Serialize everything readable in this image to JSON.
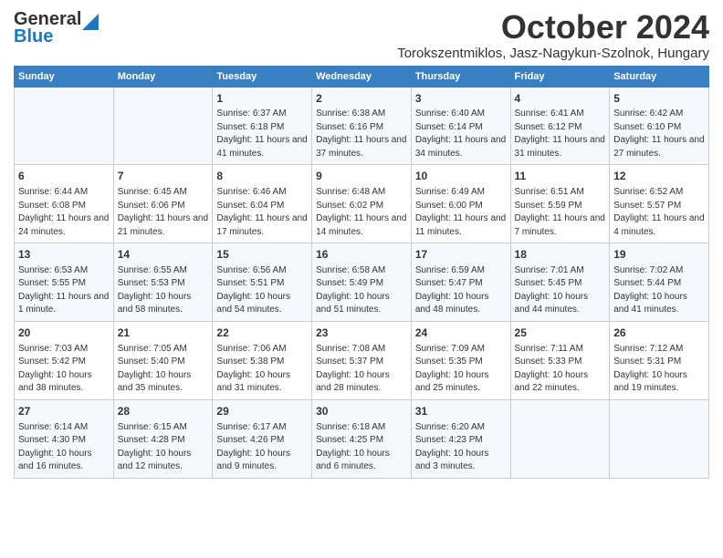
{
  "header": {
    "logo_general": "General",
    "logo_blue": "Blue",
    "month_title": "October 2024",
    "location": "Torokszentmiklos, Jasz-Nagykun-Szolnok, Hungary"
  },
  "days_of_week": [
    "Sunday",
    "Monday",
    "Tuesday",
    "Wednesday",
    "Thursday",
    "Friday",
    "Saturday"
  ],
  "weeks": [
    [
      {
        "day": "",
        "info": ""
      },
      {
        "day": "",
        "info": ""
      },
      {
        "day": "1",
        "info": "Sunrise: 6:37 AM\nSunset: 6:18 PM\nDaylight: 11 hours and 41 minutes."
      },
      {
        "day": "2",
        "info": "Sunrise: 6:38 AM\nSunset: 6:16 PM\nDaylight: 11 hours and 37 minutes."
      },
      {
        "day": "3",
        "info": "Sunrise: 6:40 AM\nSunset: 6:14 PM\nDaylight: 11 hours and 34 minutes."
      },
      {
        "day": "4",
        "info": "Sunrise: 6:41 AM\nSunset: 6:12 PM\nDaylight: 11 hours and 31 minutes."
      },
      {
        "day": "5",
        "info": "Sunrise: 6:42 AM\nSunset: 6:10 PM\nDaylight: 11 hours and 27 minutes."
      }
    ],
    [
      {
        "day": "6",
        "info": "Sunrise: 6:44 AM\nSunset: 6:08 PM\nDaylight: 11 hours and 24 minutes."
      },
      {
        "day": "7",
        "info": "Sunrise: 6:45 AM\nSunset: 6:06 PM\nDaylight: 11 hours and 21 minutes."
      },
      {
        "day": "8",
        "info": "Sunrise: 6:46 AM\nSunset: 6:04 PM\nDaylight: 11 hours and 17 minutes."
      },
      {
        "day": "9",
        "info": "Sunrise: 6:48 AM\nSunset: 6:02 PM\nDaylight: 11 hours and 14 minutes."
      },
      {
        "day": "10",
        "info": "Sunrise: 6:49 AM\nSunset: 6:00 PM\nDaylight: 11 hours and 11 minutes."
      },
      {
        "day": "11",
        "info": "Sunrise: 6:51 AM\nSunset: 5:59 PM\nDaylight: 11 hours and 7 minutes."
      },
      {
        "day": "12",
        "info": "Sunrise: 6:52 AM\nSunset: 5:57 PM\nDaylight: 11 hours and 4 minutes."
      }
    ],
    [
      {
        "day": "13",
        "info": "Sunrise: 6:53 AM\nSunset: 5:55 PM\nDaylight: 11 hours and 1 minute."
      },
      {
        "day": "14",
        "info": "Sunrise: 6:55 AM\nSunset: 5:53 PM\nDaylight: 10 hours and 58 minutes."
      },
      {
        "day": "15",
        "info": "Sunrise: 6:56 AM\nSunset: 5:51 PM\nDaylight: 10 hours and 54 minutes."
      },
      {
        "day": "16",
        "info": "Sunrise: 6:58 AM\nSunset: 5:49 PM\nDaylight: 10 hours and 51 minutes."
      },
      {
        "day": "17",
        "info": "Sunrise: 6:59 AM\nSunset: 5:47 PM\nDaylight: 10 hours and 48 minutes."
      },
      {
        "day": "18",
        "info": "Sunrise: 7:01 AM\nSunset: 5:45 PM\nDaylight: 10 hours and 44 minutes."
      },
      {
        "day": "19",
        "info": "Sunrise: 7:02 AM\nSunset: 5:44 PM\nDaylight: 10 hours and 41 minutes."
      }
    ],
    [
      {
        "day": "20",
        "info": "Sunrise: 7:03 AM\nSunset: 5:42 PM\nDaylight: 10 hours and 38 minutes."
      },
      {
        "day": "21",
        "info": "Sunrise: 7:05 AM\nSunset: 5:40 PM\nDaylight: 10 hours and 35 minutes."
      },
      {
        "day": "22",
        "info": "Sunrise: 7:06 AM\nSunset: 5:38 PM\nDaylight: 10 hours and 31 minutes."
      },
      {
        "day": "23",
        "info": "Sunrise: 7:08 AM\nSunset: 5:37 PM\nDaylight: 10 hours and 28 minutes."
      },
      {
        "day": "24",
        "info": "Sunrise: 7:09 AM\nSunset: 5:35 PM\nDaylight: 10 hours and 25 minutes."
      },
      {
        "day": "25",
        "info": "Sunrise: 7:11 AM\nSunset: 5:33 PM\nDaylight: 10 hours and 22 minutes."
      },
      {
        "day": "26",
        "info": "Sunrise: 7:12 AM\nSunset: 5:31 PM\nDaylight: 10 hours and 19 minutes."
      }
    ],
    [
      {
        "day": "27",
        "info": "Sunrise: 6:14 AM\nSunset: 4:30 PM\nDaylight: 10 hours and 16 minutes."
      },
      {
        "day": "28",
        "info": "Sunrise: 6:15 AM\nSunset: 4:28 PM\nDaylight: 10 hours and 12 minutes."
      },
      {
        "day": "29",
        "info": "Sunrise: 6:17 AM\nSunset: 4:26 PM\nDaylight: 10 hours and 9 minutes."
      },
      {
        "day": "30",
        "info": "Sunrise: 6:18 AM\nSunset: 4:25 PM\nDaylight: 10 hours and 6 minutes."
      },
      {
        "day": "31",
        "info": "Sunrise: 6:20 AM\nSunset: 4:23 PM\nDaylight: 10 hours and 3 minutes."
      },
      {
        "day": "",
        "info": ""
      },
      {
        "day": "",
        "info": ""
      }
    ]
  ]
}
